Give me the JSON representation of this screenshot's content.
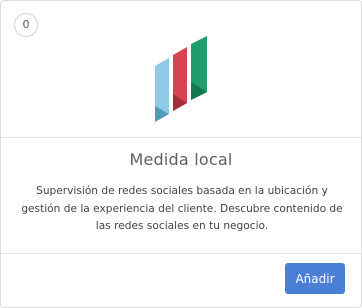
{
  "card": {
    "badge_count": "0",
    "logo_icon": "local-measure-logo-icon",
    "title": "Medida local",
    "description": "Supervisión de redes sociales basada en la ubicación y gestión de la experiencia del cliente. Descubre contenido de las redes sociales en tu negocio.",
    "add_button_label": "Añadir"
  },
  "colors": {
    "logo_blue": "#8ecae6",
    "logo_blue_dark": "#4f9bbd",
    "logo_red": "#d9434f",
    "logo_red_dark": "#a32e3b",
    "logo_green": "#1f9e6b",
    "logo_green_dark": "#137a50",
    "button": "#4a7fd6"
  }
}
